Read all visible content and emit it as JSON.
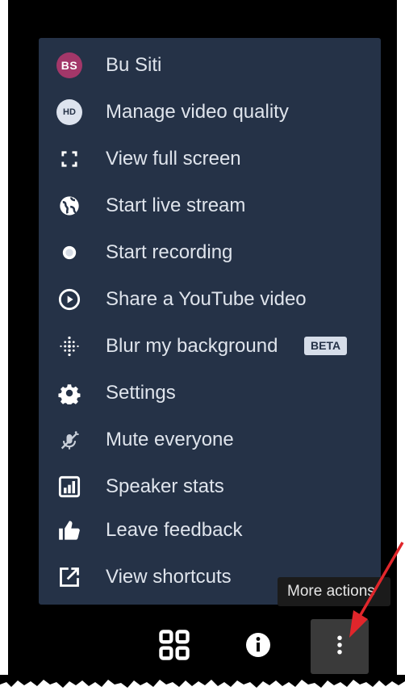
{
  "menu": {
    "items": [
      {
        "label": "Bu Siti",
        "icon": "avatar-initials",
        "initials": "BS"
      },
      {
        "label": "Manage video quality",
        "icon": "hd-icon",
        "badge": "HD"
      },
      {
        "label": "View full screen",
        "icon": "fullscreen-icon"
      },
      {
        "label": "Start live stream",
        "icon": "globe-icon"
      },
      {
        "label": "Start recording",
        "icon": "record-icon"
      },
      {
        "label": "Share a YouTube video",
        "icon": "play-circle-icon"
      },
      {
        "label": "Blur my background",
        "icon": "blur-dots-icon",
        "tag": "BETA"
      },
      {
        "label": "Settings",
        "icon": "gear-icon"
      },
      {
        "label": "Mute everyone",
        "icon": "mic-muted-icon"
      },
      {
        "label": "Speaker stats",
        "icon": "bar-chart-icon"
      },
      {
        "label": "Leave feedback",
        "icon": "thumbs-up-icon"
      },
      {
        "label": "View shortcuts",
        "icon": "external-link-icon"
      }
    ]
  },
  "tooltip": {
    "text": "More actions"
  },
  "toolbar": {
    "buttons": [
      {
        "name": "tile-view",
        "icon": "grid-icon"
      },
      {
        "name": "info",
        "icon": "info-icon"
      },
      {
        "name": "more-actions",
        "icon": "more-vertical-icon"
      }
    ]
  },
  "colors": {
    "menu_bg": "#253247",
    "menu_text": "#dfe4ec",
    "avatar_bg": "#a33769",
    "arrow": "#e0262b",
    "page_bg": "#000000"
  }
}
